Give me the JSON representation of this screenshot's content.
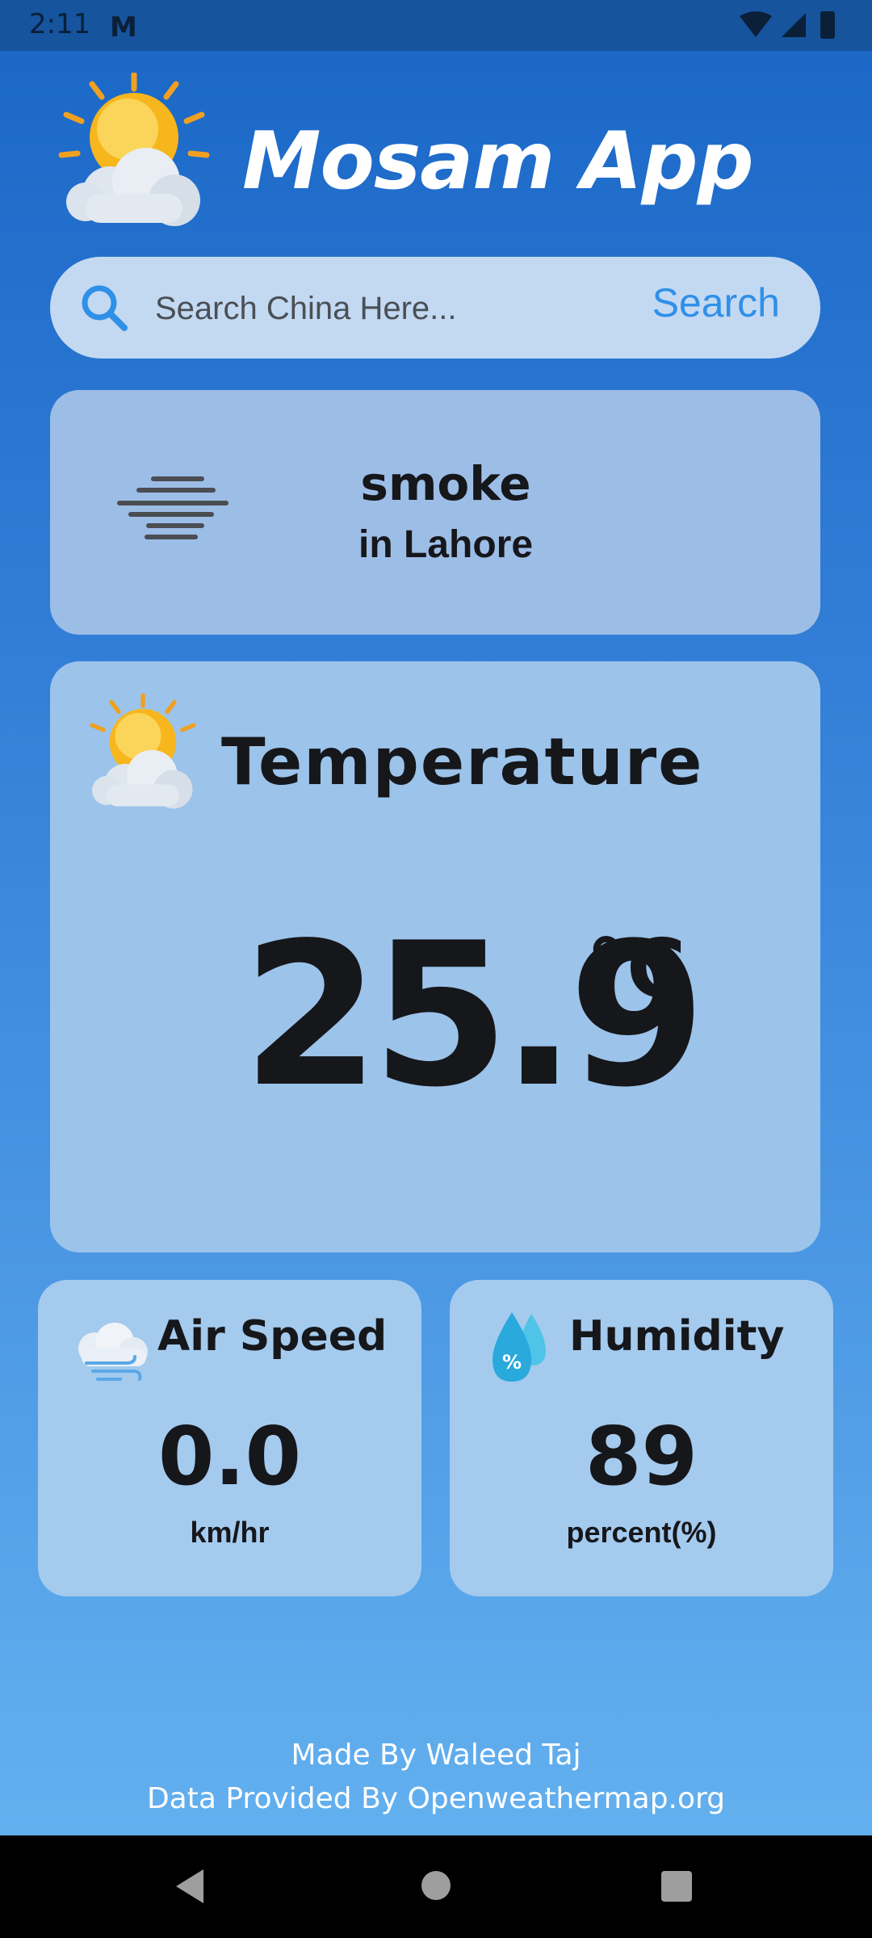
{
  "status_bar": {
    "time": "2:11",
    "mail_glyph": "M",
    "icons": [
      "wifi-icon",
      "signal-icon",
      "battery-icon"
    ]
  },
  "header": {
    "title": "Mosam App",
    "logo_icon": "sun-cloud-icon"
  },
  "search": {
    "placeholder": "Search China Here...",
    "value": "",
    "button_label": "Search",
    "icon": "search-icon"
  },
  "condition": {
    "name": "smoke",
    "city": "in Lahore",
    "icon": "smoke-icon"
  },
  "temperature": {
    "heading": "Temperature",
    "value": "25.9",
    "unit": "°C",
    "icon": "sun-cloud-icon"
  },
  "air_speed": {
    "heading": "Air Speed",
    "value": "0.0",
    "unit": "km/hr",
    "icon": "wind-icon"
  },
  "humidity": {
    "heading": "Humidity",
    "value": "89",
    "unit": "percent(%)",
    "icon": "water-drop-icon"
  },
  "footer": {
    "line1": "Made By Waleed Taj",
    "line2": "Data Provided By Openweathermap.org"
  },
  "colors": {
    "accent": "#2f90e8",
    "text_dark": "#16171b",
    "status_bar": "#16549e"
  }
}
